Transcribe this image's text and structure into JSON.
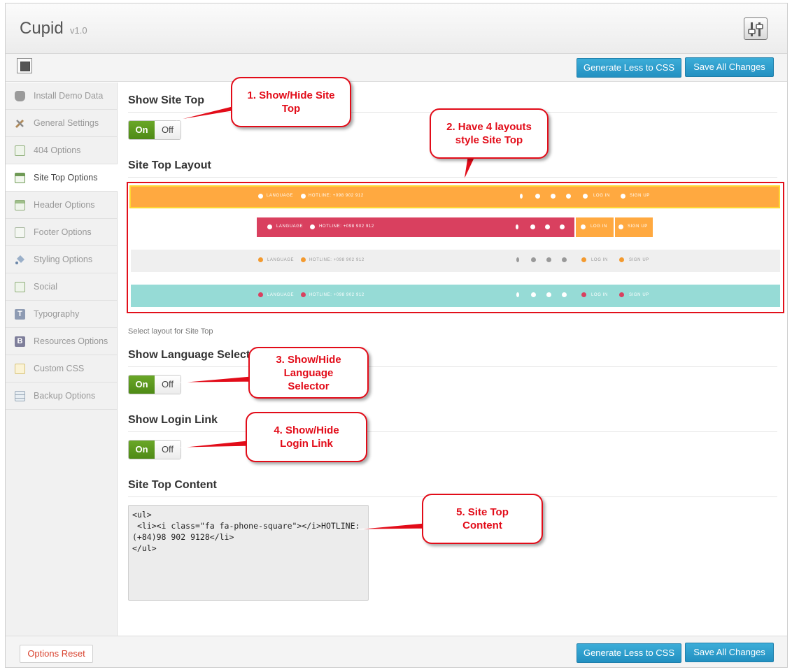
{
  "app": {
    "title": "Cupid",
    "version": "v1.0"
  },
  "toolbar": {
    "generate_label": "Generate Less to CSS",
    "save_label": "Save All Changes"
  },
  "footer": {
    "reset_label": "Options Reset",
    "generate_label": "Generate Less to CSS",
    "save_label": "Save All Changes"
  },
  "sidebar": {
    "items": [
      {
        "label": "Install Demo Data",
        "icon": "database-icon",
        "active": false
      },
      {
        "label": "General Settings",
        "icon": "tools-icon",
        "active": false
      },
      {
        "label": "404 Options",
        "icon": "layout-icon",
        "active": false
      },
      {
        "label": "Site Top Options",
        "icon": "layout-icon",
        "active": true
      },
      {
        "label": "Header Options",
        "icon": "layout-icon",
        "active": false
      },
      {
        "label": "Footer Options",
        "icon": "page-icon",
        "active": false
      },
      {
        "label": "Styling Options",
        "icon": "paint-bucket-icon",
        "active": false
      },
      {
        "label": "Social",
        "icon": "layout-icon",
        "active": false
      },
      {
        "label": "Typography",
        "icon": "t-letter-icon",
        "active": false
      },
      {
        "label": "Resources Options",
        "icon": "b-letter-icon",
        "active": false
      },
      {
        "label": "Custom CSS",
        "icon": "css-icon",
        "active": false
      },
      {
        "label": "Backup Options",
        "icon": "backup-icon",
        "active": false
      }
    ]
  },
  "main": {
    "show_site_top": {
      "title": "Show Site Top",
      "on": "On",
      "off": "Off",
      "value": "On"
    },
    "layout": {
      "title": "Site Top Layout",
      "helper": "Select layout for Site Top",
      "bars": [
        {
          "language": "LANGUAGE",
          "hotline": "HOTLINE: +098 902 912",
          "login": "LOG IN",
          "signup": "SIGN UP",
          "color": "#ffa940"
        },
        {
          "language": "LANGUAGE",
          "hotline": "HOTLINE: +098 902 912",
          "login": "LOG IN",
          "signup": "SIGN UP",
          "color": "#d9405f",
          "accent": "#ffa940"
        },
        {
          "language": "LANGUAGE",
          "hotline": "HOTLINE: +098 902 912",
          "login": "LOG IN",
          "signup": "SIGN UP",
          "color": "#efefef"
        },
        {
          "language": "LANGUAGE",
          "hotline": "HOTLINE: +098 902 912",
          "login": "LOG IN",
          "signup": "SIGN UP",
          "color": "#96dbd6"
        }
      ]
    },
    "show_language": {
      "title": "Show Language Selector",
      "on": "On",
      "off": "Off",
      "value": "On"
    },
    "show_login": {
      "title": "Show Login Link",
      "on": "On",
      "off": "Off",
      "value": "On"
    },
    "content": {
      "title": "Site Top Content",
      "value": "<ul>\n <li><i class=\"fa fa-phone-square\"></i>HOTLINE: (+84)98 902 9128</li>\n</ul>"
    }
  },
  "callouts": [
    {
      "line1": "1. Show/Hide Site",
      "line2": "Top"
    },
    {
      "line1": "2. Have 4 layouts",
      "line2": "style Site Top"
    },
    {
      "line1": "3. Show/Hide",
      "line2": "Language",
      "line3": "Selector"
    },
    {
      "line1": "4. Show/Hide",
      "line2": "Login Link"
    },
    {
      "line1": "5. Site Top",
      "line2": "Content"
    }
  ],
  "colors": {
    "accent_blue": "#2a9bd0",
    "toggle_green": "#5c9a1f",
    "callout_red": "#e20c19"
  }
}
